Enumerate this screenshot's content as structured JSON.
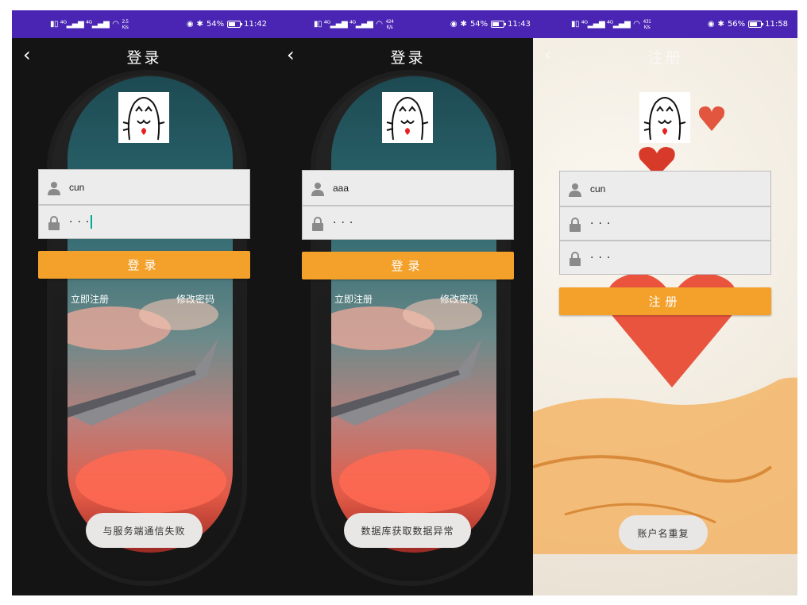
{
  "screens": [
    {
      "status": {
        "time": "11:42",
        "battery": "54%",
        "speed_num": "2.5",
        "speed_unit": "K/s",
        "battery_fill": 0.54
      },
      "title": "登录",
      "username": "cun",
      "password": "···",
      "button": "登录",
      "link_register": "立即注册",
      "link_change_password": "修改密码",
      "toast": "与服务端通信失败"
    },
    {
      "status": {
        "time": "11:43",
        "battery": "54%",
        "speed_num": "424",
        "speed_unit": "K/s",
        "battery_fill": 0.54
      },
      "title": "登录",
      "username": "aaa",
      "password": "···",
      "button": "登录",
      "link_register": "立即注册",
      "link_change_password": "修改密码",
      "toast": "数据库获取数据异常"
    },
    {
      "status": {
        "time": "11:58",
        "battery": "56%",
        "speed_num": "431",
        "speed_unit": "K/s",
        "battery_fill": 0.56
      },
      "title": "注册",
      "username": "cun",
      "password": "···",
      "confirm_password": "···",
      "button": "注册",
      "toast": "账户名重复"
    }
  ],
  "icons": {
    "back": "back-arrow-icon",
    "user": "user-icon",
    "lock": "lock-icon",
    "eye": "eye-icon",
    "bluetooth": "bluetooth-icon",
    "battery": "battery-icon",
    "wifi": "wifi-icon",
    "signal": "signal-icon"
  },
  "colors": {
    "status_bar": "#4a25b4",
    "button": "#f3a12b",
    "cursor": "#00a896",
    "toast_bg": "#e9e7e6"
  }
}
